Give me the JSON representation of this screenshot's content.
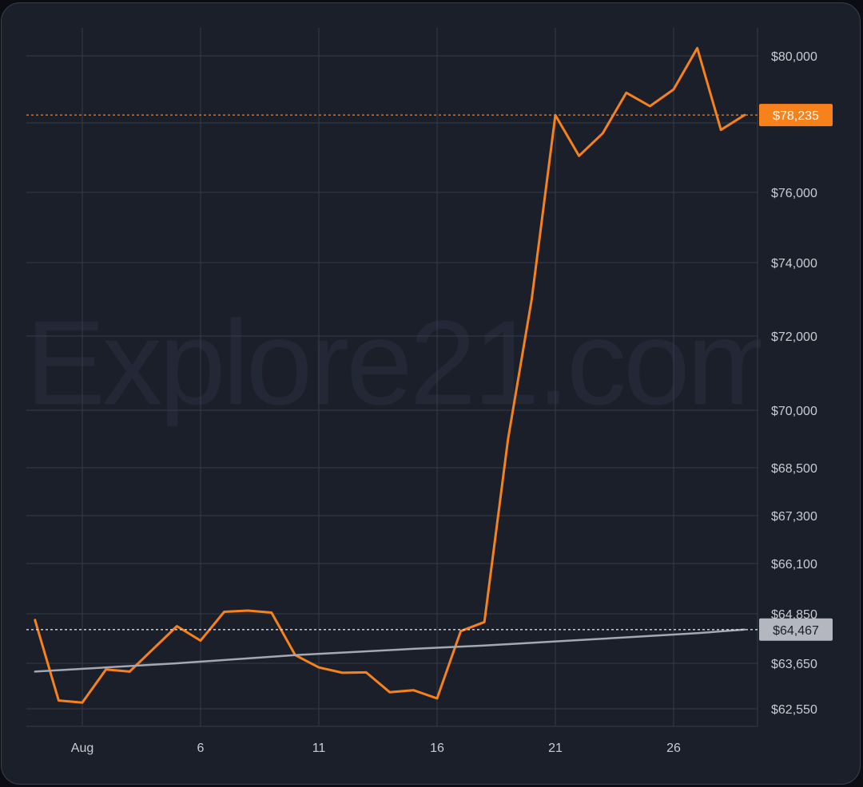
{
  "watermark": "Explore21.com",
  "colors": {
    "background": "#1b1f2a",
    "grid": "#353b49",
    "price_line": "#f7821b",
    "average_line": "#a5a8b3",
    "axis_text": "#c9ccd3",
    "price_badge_text": "#ffffff",
    "average_badge_bg": "#b4b7bf",
    "average_badge_text": "#1b1f2a"
  },
  "chart_data": {
    "type": "line",
    "x_tick_labels": [
      "Aug",
      "6",
      "11",
      "16",
      "21",
      "26"
    ],
    "x_tick_days": [
      1,
      6,
      11,
      16,
      21,
      26
    ],
    "y_tick_labels": [
      "$80,000",
      "$76,000",
      "$74,000",
      "$72,000",
      "$70,000",
      "$68,500",
      "$67,300",
      "$66,100",
      "$64,850",
      "$63,650",
      "$62,550"
    ],
    "y_tick_values": [
      80000,
      76000,
      74000,
      72000,
      70000,
      68500,
      67300,
      66100,
      64850,
      63650,
      62550
    ],
    "xlim": [
      -1.3,
      29.6
    ],
    "series": [
      {
        "key": "price",
        "x": [
          -1,
          0,
          1,
          2,
          3,
          4,
          5,
          6,
          7,
          8,
          9,
          10,
          11,
          12,
          13,
          14,
          15,
          16,
          17,
          18,
          19,
          20,
          21,
          22,
          23,
          24,
          25,
          26,
          27,
          28,
          29
        ],
        "y": [
          64700,
          62750,
          62700,
          63500,
          63450,
          64000,
          64550,
          64200,
          64900,
          64930,
          64880,
          63850,
          63550,
          63420,
          63430,
          62950,
          63000,
          62800,
          64430,
          64650,
          69250,
          73000,
          78230,
          77050,
          77700,
          78900,
          78500,
          79000,
          80230,
          77800,
          78235
        ]
      },
      {
        "key": "average",
        "x": [
          -1,
          5,
          10,
          15,
          18,
          21,
          24,
          27,
          29
        ],
        "y": [
          63450,
          63650,
          63850,
          64000,
          64080,
          64180,
          64280,
          64380,
          64467
        ]
      }
    ],
    "price_marker": {
      "label": "$78,235",
      "value": 78235
    },
    "average_marker": {
      "label": "$64,467",
      "value": 64467
    },
    "grid": true,
    "legend": "none"
  }
}
